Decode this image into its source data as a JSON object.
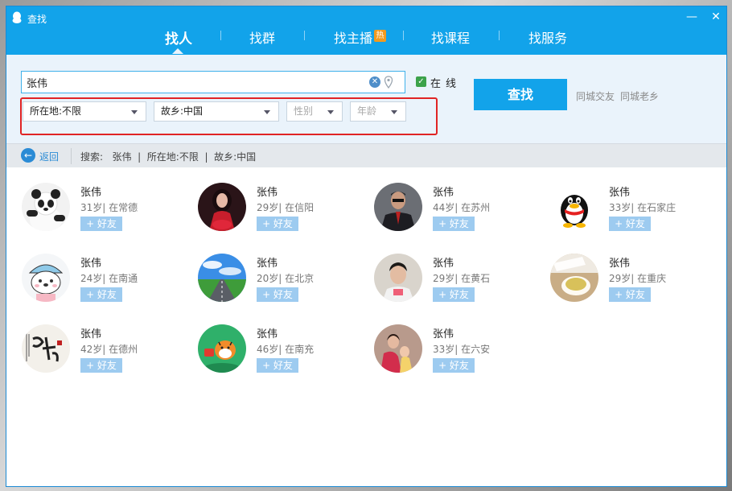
{
  "window": {
    "title": "查找",
    "minimize_glyph": "—",
    "close_glyph": "✕"
  },
  "tabs": [
    {
      "label": "找人",
      "active": true
    },
    {
      "label": "找群",
      "active": false
    },
    {
      "label": "找主播",
      "active": false,
      "badge": "热"
    },
    {
      "label": "找课程",
      "active": false
    },
    {
      "label": "找服务",
      "active": false
    }
  ],
  "tab_separator": "|",
  "search": {
    "value": "张伟",
    "online_checked": true,
    "online_label": "在线",
    "button_label": "查找",
    "link_local_friends": "同城交友",
    "link_hometown": "同城老乡"
  },
  "filters": {
    "location": "所在地:不限",
    "hometown": "故乡:中国",
    "gender_placeholder": "性别",
    "age_placeholder": "年龄"
  },
  "filter_bar": {
    "back_label": "返回",
    "summary": "搜索:   张伟  |  所在地:不限  |  故乡:中国"
  },
  "add_friend_label": "+ 好友",
  "results": [
    {
      "name": "张伟",
      "meta": "31岁| 在常德",
      "avatar": "panda"
    },
    {
      "name": "张伟",
      "meta": "29岁| 在信阳",
      "avatar": "woman-red"
    },
    {
      "name": "张伟",
      "meta": "44岁| 在苏州",
      "avatar": "man-suit"
    },
    {
      "name": "张伟",
      "meta": "33岁| 在石家庄",
      "avatar": "penguin"
    },
    {
      "name": "张伟",
      "meta": "24岁| 在南通",
      "avatar": "cartoon-bear"
    },
    {
      "name": "张伟",
      "meta": "20岁| 在北京",
      "avatar": "sky-road"
    },
    {
      "name": "张伟",
      "meta": "29岁| 在黄石",
      "avatar": "young-man"
    },
    {
      "name": "张伟",
      "meta": "29岁| 在重庆",
      "avatar": "tea-cup"
    },
    {
      "name": "张伟",
      "meta": "42岁| 在德州",
      "avatar": "calligraphy"
    },
    {
      "name": "张伟",
      "meta": "46岁| 在南充",
      "avatar": "cartoon-tiger"
    },
    {
      "name": "张伟",
      "meta": "33岁| 在六安",
      "avatar": "family-photo"
    }
  ],
  "colors": {
    "header": "#12a3ea",
    "search_button": "#12a3ea",
    "add_friend": "#9dcbf0",
    "highlight_box": "#e02424",
    "hot_badge": "#f39a1e"
  }
}
